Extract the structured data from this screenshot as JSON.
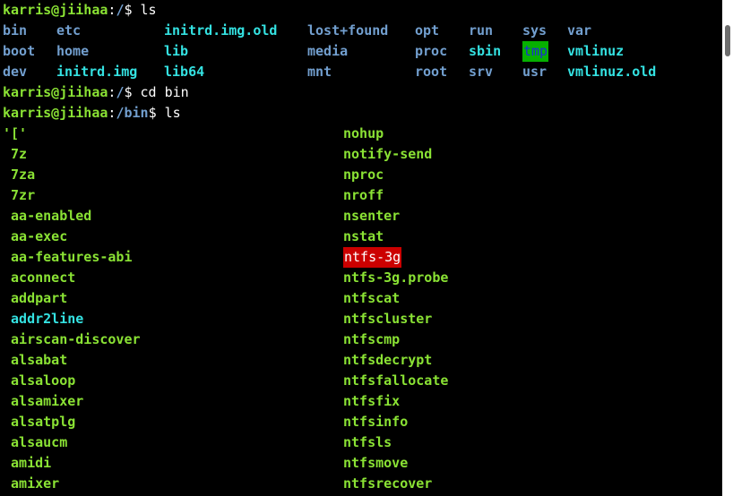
{
  "prompts": [
    {
      "user": "karris@jiihaa",
      "sep": ":",
      "path": "/",
      "sym": "$ ",
      "cmd": "ls"
    },
    {
      "user": "karris@jiihaa",
      "sep": ":",
      "path": "/",
      "sym": "$ ",
      "cmd": "cd bin"
    },
    {
      "user": "karris@jiihaa",
      "sep": ":",
      "path": "/bin",
      "sym": "$ ",
      "cmd": "ls"
    }
  ],
  "root_listing": [
    [
      "bin",
      "etc",
      "initrd.img.old",
      "lost+found",
      "opt",
      "run",
      "sys",
      "var"
    ],
    [
      "boot",
      "home",
      "lib",
      "media",
      "proc",
      "sbin",
      "tmp",
      "vmlinuz"
    ],
    [
      "dev",
      "initrd.img",
      "lib64",
      "mnt",
      "root",
      "srv",
      "usr",
      "vmlinuz.old"
    ]
  ],
  "bin_left": [
    "'['",
    " 7z",
    " 7za",
    " 7zr",
    " aa-enabled",
    " aa-exec",
    " aa-features-abi",
    " aconnect",
    " addpart",
    " addr2line",
    " airscan-discover",
    " alsabat",
    " alsaloop",
    " alsamixer",
    " alsatplg",
    " alsaucm",
    " amidi",
    " amixer"
  ],
  "bin_right": [
    "nohup",
    "notify-send",
    "nproc",
    "nroff",
    "nsenter",
    "nstat",
    "ntfs-3g",
    "ntfs-3g.probe",
    "ntfscat",
    "ntfscluster",
    "ntfscmp",
    "ntfsdecrypt",
    "ntfsfallocate",
    "ntfsfix",
    "ntfsinfo",
    "ntfsls",
    "ntfsmove",
    "ntfsrecover"
  ],
  "colors": {
    "background": "#000000",
    "prompt_user": "#8ae234",
    "prompt_path": "#729fcf",
    "directory": "#729fcf",
    "executable": "#8ae234",
    "symlink": "#34e2e2",
    "tmp_bg": "#06b000",
    "setuid_bg": "#cc0000"
  },
  "icons": {
    "scrollbar": "scrollbar-thumb"
  }
}
